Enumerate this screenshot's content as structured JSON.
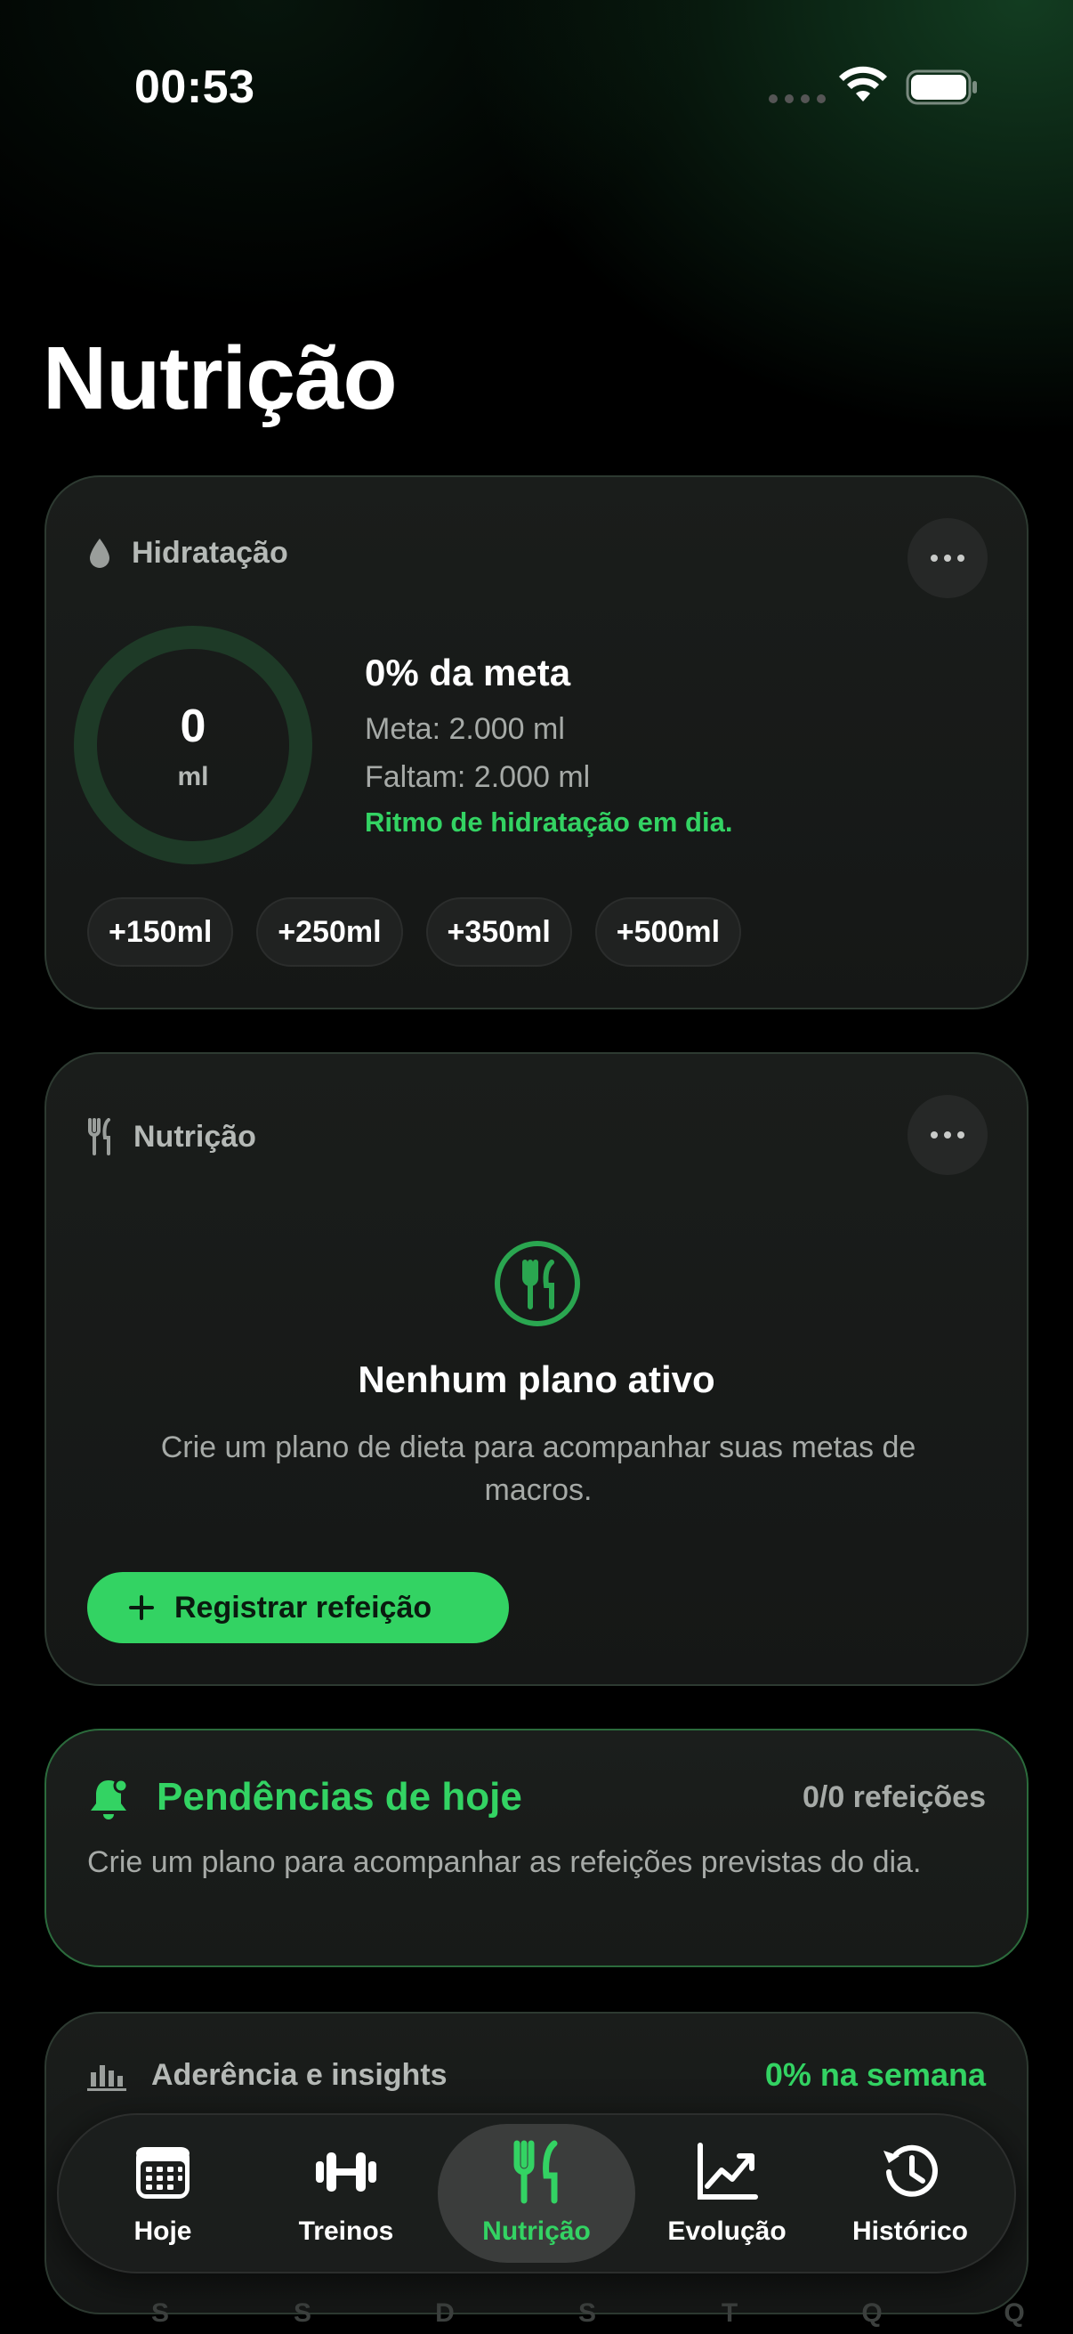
{
  "status_bar": {
    "time": "00:53"
  },
  "page": {
    "title": "Nutrição"
  },
  "hydration": {
    "label": "Hidratação",
    "ring_value": "0",
    "ring_unit": "ml",
    "progress": 0,
    "percent_text": "0% da meta",
    "goal_text": "Meta: 2.000 ml",
    "remaining_text": "Faltam: 2.000 ml",
    "status_text": "Ritmo de hidratação em dia.",
    "quick_add": [
      "+150ml",
      "+250ml",
      "+350ml",
      "+500ml"
    ]
  },
  "nutrition": {
    "label": "Nutrição",
    "empty_title": "Nenhum plano ativo",
    "empty_text": "Crie um plano de dieta para acompanhar suas metas de macros.",
    "register_button": "Registrar refeição"
  },
  "pending": {
    "title": "Pendências de hoje",
    "count": "0/0 refeições",
    "text": "Crie um plano para acompanhar as refeições previstas do dia."
  },
  "adherence": {
    "title": "Aderência e insights",
    "week_value": "0% na semana",
    "days": [
      "S",
      "S",
      "D",
      "S",
      "T",
      "Q",
      "Q"
    ]
  },
  "tab_bar": {
    "tabs": [
      {
        "label": "Hoje",
        "icon": "calendar-icon",
        "active": false
      },
      {
        "label": "Treinos",
        "icon": "dumbbell-icon",
        "active": false
      },
      {
        "label": "Nutrição",
        "icon": "fork-knife-icon",
        "active": true
      },
      {
        "label": "Evolução",
        "icon": "chart-line-icon",
        "active": false
      },
      {
        "label": "Histórico",
        "icon": "history-icon",
        "active": false
      }
    ]
  },
  "colors": {
    "accent": "#33d363",
    "background": "#000000",
    "card": "#1a1d1b"
  }
}
